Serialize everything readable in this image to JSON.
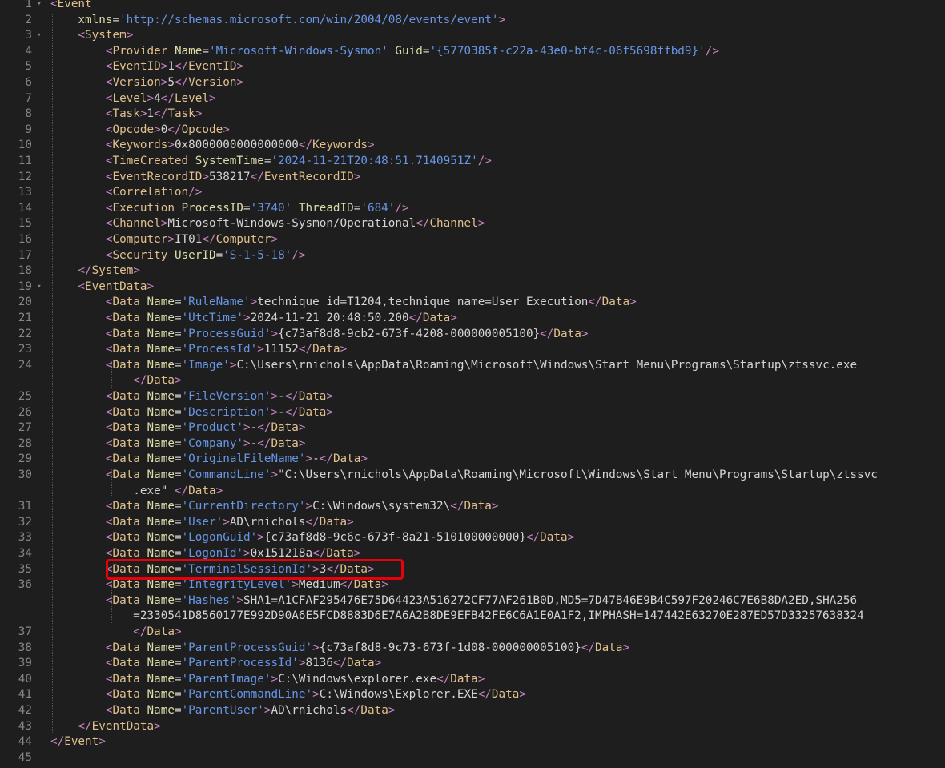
{
  "editor": {
    "language": "xml",
    "highlight_color": "#e8000b",
    "line_number_color": "#858585",
    "line_numbers": [
      "1",
      "2",
      "3",
      "4",
      "5",
      "6",
      "7",
      "8",
      "9",
      "10",
      "11",
      "12",
      "13",
      "14",
      "15",
      "16",
      "17",
      "18",
      "19",
      "20",
      "21",
      "22",
      "23",
      "24",
      "25",
      "26",
      "27",
      "28",
      "29",
      "30",
      "31",
      "32",
      "33",
      "34",
      "35",
      "36",
      "37",
      "38",
      "39",
      "40",
      "41",
      "42",
      "43",
      "44",
      "45"
    ],
    "fold_markers": [
      {
        "line": "1",
        "icon": "chevron-down-icon"
      },
      {
        "line": "3",
        "icon": "chevron-down-icon"
      },
      {
        "line": "19",
        "icon": "chevron-down-icon"
      }
    ],
    "highlighted_line": "35"
  },
  "lines": [
    [
      [
        "tag",
        "<"
      ],
      [
        "elem",
        "Event"
      ]
    ],
    [
      [
        "attr",
        "    xmlns"
      ],
      [
        "punct",
        "="
      ],
      [
        "str",
        "'http://schemas.microsoft.com/win/2004/08/events/event'"
      ],
      [
        "tag",
        ">"
      ]
    ],
    [
      [
        "tag",
        "    <"
      ],
      [
        "elem",
        "System"
      ],
      [
        "tag",
        ">"
      ]
    ],
    [
      [
        "tag",
        "        <"
      ],
      [
        "elem",
        "Provider "
      ],
      [
        "attr",
        "Name"
      ],
      [
        "punct",
        "="
      ],
      [
        "str",
        "'Microsoft-Windows-Sysmon'"
      ],
      [
        "attr",
        " Guid"
      ],
      [
        "punct",
        "="
      ],
      [
        "str",
        "'{5770385f-c22a-43e0-bf4c-06f5698ffbd9}'"
      ],
      [
        "tag",
        "/>"
      ]
    ],
    [
      [
        "tag",
        "        <"
      ],
      [
        "elem",
        "EventID"
      ],
      [
        "tag",
        ">"
      ],
      [
        "text",
        "1"
      ],
      [
        "tag",
        "</"
      ],
      [
        "elem",
        "EventID"
      ],
      [
        "tag",
        ">"
      ]
    ],
    [
      [
        "tag",
        "        <"
      ],
      [
        "elem",
        "Version"
      ],
      [
        "tag",
        ">"
      ],
      [
        "text",
        "5"
      ],
      [
        "tag",
        "</"
      ],
      [
        "elem",
        "Version"
      ],
      [
        "tag",
        ">"
      ]
    ],
    [
      [
        "tag",
        "        <"
      ],
      [
        "elem",
        "Level"
      ],
      [
        "tag",
        ">"
      ],
      [
        "text",
        "4"
      ],
      [
        "tag",
        "</"
      ],
      [
        "elem",
        "Level"
      ],
      [
        "tag",
        ">"
      ]
    ],
    [
      [
        "tag",
        "        <"
      ],
      [
        "elem",
        "Task"
      ],
      [
        "tag",
        ">"
      ],
      [
        "text",
        "1"
      ],
      [
        "tag",
        "</"
      ],
      [
        "elem",
        "Task"
      ],
      [
        "tag",
        ">"
      ]
    ],
    [
      [
        "tag",
        "        <"
      ],
      [
        "elem",
        "Opcode"
      ],
      [
        "tag",
        ">"
      ],
      [
        "text",
        "0"
      ],
      [
        "tag",
        "</"
      ],
      [
        "elem",
        "Opcode"
      ],
      [
        "tag",
        ">"
      ]
    ],
    [
      [
        "tag",
        "        <"
      ],
      [
        "elem",
        "Keywords"
      ],
      [
        "tag",
        ">"
      ],
      [
        "text",
        "0x8000000000000000"
      ],
      [
        "tag",
        "</"
      ],
      [
        "elem",
        "Keywords"
      ],
      [
        "tag",
        ">"
      ]
    ],
    [
      [
        "tag",
        "        <"
      ],
      [
        "elem",
        "TimeCreated "
      ],
      [
        "attr",
        "SystemTime"
      ],
      [
        "punct",
        "="
      ],
      [
        "str",
        "'2024-11-21T20:48:51.7140951Z'"
      ],
      [
        "tag",
        "/>"
      ]
    ],
    [
      [
        "tag",
        "        <"
      ],
      [
        "elem",
        "EventRecordID"
      ],
      [
        "tag",
        ">"
      ],
      [
        "text",
        "538217"
      ],
      [
        "tag",
        "</"
      ],
      [
        "elem",
        "EventRecordID"
      ],
      [
        "tag",
        ">"
      ]
    ],
    [
      [
        "tag",
        "        <"
      ],
      [
        "elem",
        "Correlation"
      ],
      [
        "tag",
        "/>"
      ]
    ],
    [
      [
        "tag",
        "        <"
      ],
      [
        "elem",
        "Execution "
      ],
      [
        "attr",
        "ProcessID"
      ],
      [
        "punct",
        "="
      ],
      [
        "str",
        "'3740'"
      ],
      [
        "attr",
        " ThreadID"
      ],
      [
        "punct",
        "="
      ],
      [
        "str",
        "'684'"
      ],
      [
        "tag",
        "/>"
      ]
    ],
    [
      [
        "tag",
        "        <"
      ],
      [
        "elem",
        "Channel"
      ],
      [
        "tag",
        ">"
      ],
      [
        "text",
        "Microsoft-Windows-Sysmon/Operational"
      ],
      [
        "tag",
        "</"
      ],
      [
        "elem",
        "Channel"
      ],
      [
        "tag",
        ">"
      ]
    ],
    [
      [
        "tag",
        "        <"
      ],
      [
        "elem",
        "Computer"
      ],
      [
        "tag",
        ">"
      ],
      [
        "text",
        "IT01"
      ],
      [
        "tag",
        "</"
      ],
      [
        "elem",
        "Computer"
      ],
      [
        "tag",
        ">"
      ]
    ],
    [
      [
        "tag",
        "        <"
      ],
      [
        "elem",
        "Security "
      ],
      [
        "attr",
        "UserID"
      ],
      [
        "punct",
        "="
      ],
      [
        "str",
        "'S-1-5-18'"
      ],
      [
        "tag",
        "/>"
      ]
    ],
    [
      [
        "tag",
        "    </"
      ],
      [
        "elem",
        "System"
      ],
      [
        "tag",
        ">"
      ]
    ],
    [
      [
        "tag",
        "    <"
      ],
      [
        "elem",
        "EventData"
      ],
      [
        "tag",
        ">"
      ]
    ],
    [
      [
        "tag",
        "        <"
      ],
      [
        "elem",
        "Data "
      ],
      [
        "attr",
        "Name"
      ],
      [
        "punct",
        "="
      ],
      [
        "str",
        "'RuleName'"
      ],
      [
        "tag",
        ">"
      ],
      [
        "text",
        "technique_id=T1204,technique_name=User Execution"
      ],
      [
        "tag",
        "</"
      ],
      [
        "elem",
        "Data"
      ],
      [
        "tag",
        ">"
      ]
    ],
    [
      [
        "tag",
        "        <"
      ],
      [
        "elem",
        "Data "
      ],
      [
        "attr",
        "Name"
      ],
      [
        "punct",
        "="
      ],
      [
        "str",
        "'UtcTime'"
      ],
      [
        "tag",
        ">"
      ],
      [
        "text",
        "2024-11-21 20:48:50.200"
      ],
      [
        "tag",
        "</"
      ],
      [
        "elem",
        "Data"
      ],
      [
        "tag",
        ">"
      ]
    ],
    [
      [
        "tag",
        "        <"
      ],
      [
        "elem",
        "Data "
      ],
      [
        "attr",
        "Name"
      ],
      [
        "punct",
        "="
      ],
      [
        "str",
        "'ProcessGuid'"
      ],
      [
        "tag",
        ">"
      ],
      [
        "text",
        "{c73af8d8-9cb2-673f-4208-000000005100}"
      ],
      [
        "tag",
        "</"
      ],
      [
        "elem",
        "Data"
      ],
      [
        "tag",
        ">"
      ]
    ],
    [
      [
        "tag",
        "        <"
      ],
      [
        "elem",
        "Data "
      ],
      [
        "attr",
        "Name"
      ],
      [
        "punct",
        "="
      ],
      [
        "str",
        "'ProcessId'"
      ],
      [
        "tag",
        ">"
      ],
      [
        "text",
        "11152"
      ],
      [
        "tag",
        "</"
      ],
      [
        "elem",
        "Data"
      ],
      [
        "tag",
        ">"
      ]
    ],
    [
      [
        "tag",
        "        <"
      ],
      [
        "elem",
        "Data "
      ],
      [
        "attr",
        "Name"
      ],
      [
        "punct",
        "="
      ],
      [
        "str",
        "'Image'"
      ],
      [
        "tag",
        ">"
      ],
      [
        "text",
        "C:\\Users\\rnichols\\AppData\\Roaming\\Microsoft\\Windows\\Start Menu\\Programs\\Startup\\ztssvc.exe"
      ]
    ],
    [
      [
        "tag",
        "            </"
      ],
      [
        "elem",
        "Data"
      ],
      [
        "tag",
        ">"
      ]
    ],
    [
      [
        "tag",
        "        <"
      ],
      [
        "elem",
        "Data "
      ],
      [
        "attr",
        "Name"
      ],
      [
        "punct",
        "="
      ],
      [
        "str",
        "'FileVersion'"
      ],
      [
        "tag",
        ">"
      ],
      [
        "text",
        "-"
      ],
      [
        "tag",
        "</"
      ],
      [
        "elem",
        "Data"
      ],
      [
        "tag",
        ">"
      ]
    ],
    [
      [
        "tag",
        "        <"
      ],
      [
        "elem",
        "Data "
      ],
      [
        "attr",
        "Name"
      ],
      [
        "punct",
        "="
      ],
      [
        "str",
        "'Description'"
      ],
      [
        "tag",
        ">"
      ],
      [
        "text",
        "-"
      ],
      [
        "tag",
        "</"
      ],
      [
        "elem",
        "Data"
      ],
      [
        "tag",
        ">"
      ]
    ],
    [
      [
        "tag",
        "        <"
      ],
      [
        "elem",
        "Data "
      ],
      [
        "attr",
        "Name"
      ],
      [
        "punct",
        "="
      ],
      [
        "str",
        "'Product'"
      ],
      [
        "tag",
        ">"
      ],
      [
        "text",
        "-"
      ],
      [
        "tag",
        "</"
      ],
      [
        "elem",
        "Data"
      ],
      [
        "tag",
        ">"
      ]
    ],
    [
      [
        "tag",
        "        <"
      ],
      [
        "elem",
        "Data "
      ],
      [
        "attr",
        "Name"
      ],
      [
        "punct",
        "="
      ],
      [
        "str",
        "'Company'"
      ],
      [
        "tag",
        ">"
      ],
      [
        "text",
        "-"
      ],
      [
        "tag",
        "</"
      ],
      [
        "elem",
        "Data"
      ],
      [
        "tag",
        ">"
      ]
    ],
    [
      [
        "tag",
        "        <"
      ],
      [
        "elem",
        "Data "
      ],
      [
        "attr",
        "Name"
      ],
      [
        "punct",
        "="
      ],
      [
        "str",
        "'OriginalFileName'"
      ],
      [
        "tag",
        ">"
      ],
      [
        "text",
        "-"
      ],
      [
        "tag",
        "</"
      ],
      [
        "elem",
        "Data"
      ],
      [
        "tag",
        ">"
      ]
    ],
    [
      [
        "tag",
        "        <"
      ],
      [
        "elem",
        "Data "
      ],
      [
        "attr",
        "Name"
      ],
      [
        "punct",
        "="
      ],
      [
        "str",
        "'CommandLine'"
      ],
      [
        "tag",
        ">"
      ],
      [
        "text",
        "\"C:\\Users\\rnichols\\AppData\\Roaming\\Microsoft\\Windows\\Start Menu\\Programs\\Startup\\ztssvc"
      ]
    ],
    [
      [
        "text",
        "            .exe\" "
      ],
      [
        "tag",
        "</"
      ],
      [
        "elem",
        "Data"
      ],
      [
        "tag",
        ">"
      ]
    ],
    [
      [
        "tag",
        "        <"
      ],
      [
        "elem",
        "Data "
      ],
      [
        "attr",
        "Name"
      ],
      [
        "punct",
        "="
      ],
      [
        "str",
        "'CurrentDirectory'"
      ],
      [
        "tag",
        ">"
      ],
      [
        "text",
        "C:\\Windows\\system32\\"
      ],
      [
        "tag",
        "</"
      ],
      [
        "elem",
        "Data"
      ],
      [
        "tag",
        ">"
      ]
    ],
    [
      [
        "tag",
        "        <"
      ],
      [
        "elem",
        "Data "
      ],
      [
        "attr",
        "Name"
      ],
      [
        "punct",
        "="
      ],
      [
        "str",
        "'User'"
      ],
      [
        "tag",
        ">"
      ],
      [
        "text",
        "AD\\rnichols"
      ],
      [
        "tag",
        "</"
      ],
      [
        "elem",
        "Data"
      ],
      [
        "tag",
        ">"
      ]
    ],
    [
      [
        "tag",
        "        <"
      ],
      [
        "elem",
        "Data "
      ],
      [
        "attr",
        "Name"
      ],
      [
        "punct",
        "="
      ],
      [
        "str",
        "'LogonGuid'"
      ],
      [
        "tag",
        ">"
      ],
      [
        "text",
        "{c73af8d8-9c6c-673f-8a21-510100000000}"
      ],
      [
        "tag",
        "</"
      ],
      [
        "elem",
        "Data"
      ],
      [
        "tag",
        ">"
      ]
    ],
    [
      [
        "tag",
        "        <"
      ],
      [
        "elem",
        "Data "
      ],
      [
        "attr",
        "Name"
      ],
      [
        "punct",
        "="
      ],
      [
        "str",
        "'LogonId'"
      ],
      [
        "tag",
        ">"
      ],
      [
        "text",
        "0x151218a"
      ],
      [
        "tag",
        "</"
      ],
      [
        "elem",
        "Data"
      ],
      [
        "tag",
        ">"
      ]
    ],
    [
      [
        "tag",
        "        <"
      ],
      [
        "elem",
        "Data "
      ],
      [
        "attr",
        "Name"
      ],
      [
        "punct",
        "="
      ],
      [
        "str",
        "'TerminalSessionId'"
      ],
      [
        "tag",
        ">"
      ],
      [
        "text",
        "3"
      ],
      [
        "tag",
        "</"
      ],
      [
        "elem",
        "Data"
      ],
      [
        "tag",
        ">"
      ]
    ],
    [
      [
        "tag",
        "        <"
      ],
      [
        "elem",
        "Data "
      ],
      [
        "attr",
        "Name"
      ],
      [
        "punct",
        "="
      ],
      [
        "str",
        "'IntegrityLevel'"
      ],
      [
        "tag",
        ">"
      ],
      [
        "text",
        "Medium"
      ],
      [
        "tag",
        "</"
      ],
      [
        "elem",
        "Data"
      ],
      [
        "tag",
        ">"
      ]
    ],
    [
      [
        "tag",
        "        <"
      ],
      [
        "elem",
        "Data "
      ],
      [
        "attr",
        "Name"
      ],
      [
        "punct",
        "="
      ],
      [
        "str",
        "'Hashes'"
      ],
      [
        "tag",
        ">"
      ],
      [
        "text",
        "SHA1=A1CFAF295476E75D64423A516272CF77AF261B0D,MD5=7D47B46E9B4C597F20246C7E6B8DA2ED,SHA256"
      ]
    ],
    [
      [
        "text",
        "            =2330541D8560177E992D90A6E5FCD8883D6E7A6A2B8DE9EFB42FE6C6A1E0A1F2,IMPHASH=147442E63270E287ED57D33257638324"
      ]
    ],
    [
      [
        "tag",
        "            </"
      ],
      [
        "elem",
        "Data"
      ],
      [
        "tag",
        ">"
      ]
    ],
    [
      [
        "tag",
        "        <"
      ],
      [
        "elem",
        "Data "
      ],
      [
        "attr",
        "Name"
      ],
      [
        "punct",
        "="
      ],
      [
        "str",
        "'ParentProcessGuid'"
      ],
      [
        "tag",
        ">"
      ],
      [
        "text",
        "{c73af8d8-9c73-673f-1d08-000000005100}"
      ],
      [
        "tag",
        "</"
      ],
      [
        "elem",
        "Data"
      ],
      [
        "tag",
        ">"
      ]
    ],
    [
      [
        "tag",
        "        <"
      ],
      [
        "elem",
        "Data "
      ],
      [
        "attr",
        "Name"
      ],
      [
        "punct",
        "="
      ],
      [
        "str",
        "'ParentProcessId'"
      ],
      [
        "tag",
        ">"
      ],
      [
        "text",
        "8136"
      ],
      [
        "tag",
        "</"
      ],
      [
        "elem",
        "Data"
      ],
      [
        "tag",
        ">"
      ]
    ],
    [
      [
        "tag",
        "        <"
      ],
      [
        "elem",
        "Data "
      ],
      [
        "attr",
        "Name"
      ],
      [
        "punct",
        "="
      ],
      [
        "str",
        "'ParentImage'"
      ],
      [
        "tag",
        ">"
      ],
      [
        "text",
        "C:\\Windows\\explorer.exe"
      ],
      [
        "tag",
        "</"
      ],
      [
        "elem",
        "Data"
      ],
      [
        "tag",
        ">"
      ]
    ],
    [
      [
        "tag",
        "        <"
      ],
      [
        "elem",
        "Data "
      ],
      [
        "attr",
        "Name"
      ],
      [
        "punct",
        "="
      ],
      [
        "str",
        "'ParentCommandLine'"
      ],
      [
        "tag",
        ">"
      ],
      [
        "text",
        "C:\\Windows\\Explorer.EXE"
      ],
      [
        "tag",
        "</"
      ],
      [
        "elem",
        "Data"
      ],
      [
        "tag",
        ">"
      ]
    ],
    [
      [
        "tag",
        "        <"
      ],
      [
        "elem",
        "Data "
      ],
      [
        "attr",
        "Name"
      ],
      [
        "punct",
        "="
      ],
      [
        "str",
        "'ParentUser'"
      ],
      [
        "tag",
        ">"
      ],
      [
        "text",
        "AD\\rnichols"
      ],
      [
        "tag",
        "</"
      ],
      [
        "elem",
        "Data"
      ],
      [
        "tag",
        ">"
      ]
    ],
    [
      [
        "tag",
        "    </"
      ],
      [
        "elem",
        "EventData"
      ],
      [
        "tag",
        ">"
      ]
    ],
    [
      [
        "tag",
        "</"
      ],
      [
        "elem",
        "Event"
      ],
      [
        "tag",
        ">"
      ]
    ],
    []
  ]
}
